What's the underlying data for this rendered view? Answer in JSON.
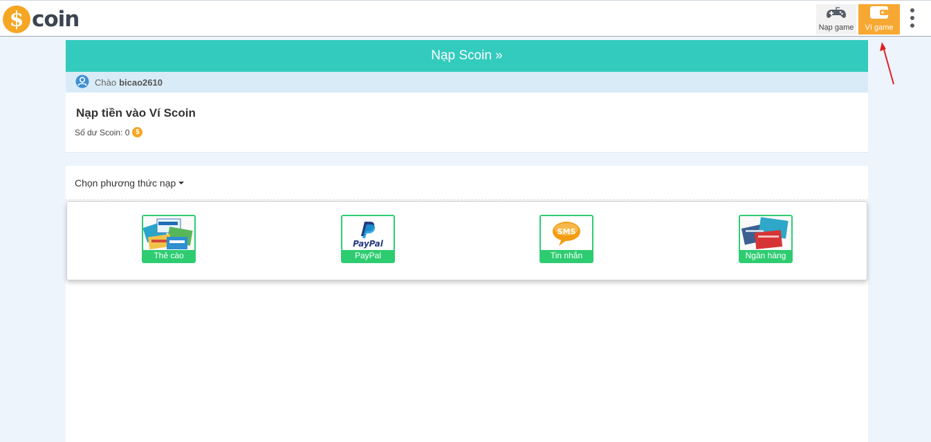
{
  "brand": {
    "logo_symbol": "$",
    "logo_text": "coin",
    "logo_color": "#f5a623"
  },
  "nav": {
    "nap_game_label": "Nạp game",
    "vi_game_label": "Ví game",
    "more_icon": "kebab-menu-icon",
    "accent": "#f7a833"
  },
  "banner": {
    "title": "Nạp Scoin »",
    "color": "#33cbbd"
  },
  "greeting": {
    "prefix": "Chào",
    "username": "bicao2610"
  },
  "wallet": {
    "title": "Nạp tiền vào Ví Scoin",
    "balance_label": "Số dư Scoin: 0",
    "coin_symbol": "$"
  },
  "methods": {
    "toggle_label": "Chọn phương thức nạp",
    "options": [
      {
        "label": "Thẻ cào",
        "icon": "scratch-cards-icon"
      },
      {
        "label": "PayPal",
        "icon": "paypal-logo-icon",
        "logo_text": "PayPal"
      },
      {
        "label": "Tin nhắn",
        "icon": "sms-bubble-icon",
        "logo_text": "SMS"
      },
      {
        "label": "Ngân hàng",
        "icon": "bank-cards-icon"
      }
    ],
    "accent": "#2ecc71"
  }
}
